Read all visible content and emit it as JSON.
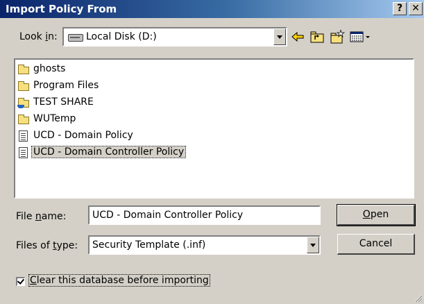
{
  "window": {
    "title": "Import Policy From",
    "help_label": "?",
    "close_label": "✕"
  },
  "lookin": {
    "label_pre": "Look ",
    "label_accel": "i",
    "label_post": "n:",
    "value": "Local Disk (D:)"
  },
  "toolbar": {
    "icons": [
      "back-icon",
      "up-one-level-icon",
      "new-folder-icon",
      "views-menu-icon"
    ]
  },
  "files": [
    {
      "name": "ghosts",
      "type": "folder"
    },
    {
      "name": "Program Files",
      "type": "folder"
    },
    {
      "name": "TEST SHARE",
      "type": "shared-folder"
    },
    {
      "name": "WUTemp",
      "type": "folder"
    },
    {
      "name": "UCD - Domain  Policy",
      "type": "template"
    },
    {
      "name": "UCD - Domain Controller Policy",
      "type": "template",
      "selected": true
    }
  ],
  "filename": {
    "label_pre": "File ",
    "label_accel": "n",
    "label_post": "ame:",
    "value": "UCD - Domain Controller Policy"
  },
  "filetype": {
    "label_pre": "Files of ",
    "label_accel": "t",
    "label_post": "ype:",
    "value": "Security Template (.inf)"
  },
  "buttons": {
    "open_accel": "O",
    "open_rest": "pen",
    "cancel": "Cancel"
  },
  "clear_db": {
    "checked": true,
    "accel": "C",
    "label_rest": "lear this database before importing"
  },
  "colors": {
    "titlebar_start": "#0a246a",
    "titlebar_end": "#a6caf0",
    "face": "#d4d0c8"
  }
}
